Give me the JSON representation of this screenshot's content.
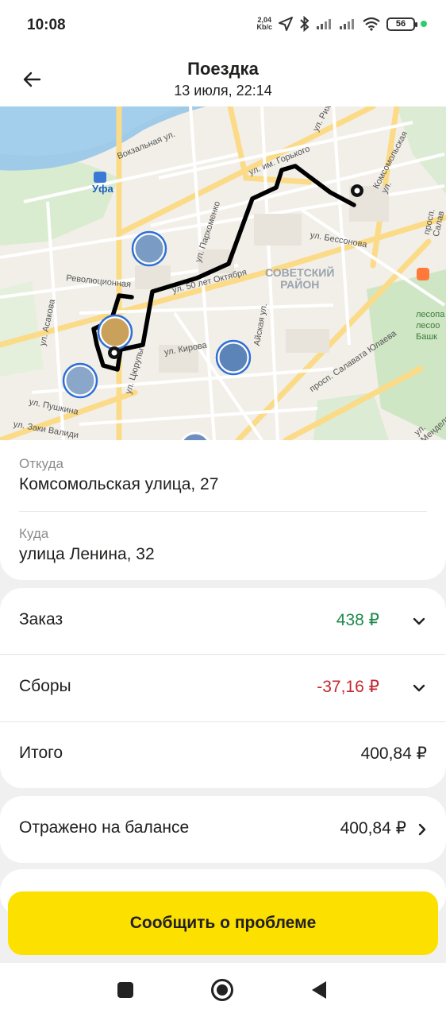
{
  "status_bar": {
    "time": "10:08",
    "net_speed_value": "2,04",
    "net_speed_unit": "Kb/c",
    "battery": "56"
  },
  "header": {
    "title": "Поездка",
    "subtitle": "13 июля, 22:14",
    "back_icon": "arrow-left-icon"
  },
  "map": {
    "streets": [
      "ул. Рихард",
      "Комсомольская ул.",
      "просп. Салав",
      "ул. им. Горького",
      "Вокзальная ул.",
      "ул. Пархоменко",
      "ул. Бессонова",
      "Революционная",
      "ул. 50 лет Октября",
      "ул. Асакова",
      "ул. Кирова",
      "Айская ул.",
      "ул. Цюрупы",
      "ул. Пушкина",
      "ул. Заки Валиди",
      "просп. Салавата Юлаева",
      "ул. Менделе"
    ],
    "district_line1": "СОВЕТСКИЙ",
    "district_line2": "РАЙОН",
    "station": "Уфа",
    "park_line1": "лесопа",
    "park_line2": "лесоо",
    "park_line3": "Башк"
  },
  "address": {
    "from_label": "Откуда",
    "from_value": "Комсомольская улица, 27",
    "to_label": "Куда",
    "to_value": "улица Ленина, 32"
  },
  "costs": {
    "order_label": "Заказ",
    "order_value": "438 ₽",
    "fees_label": "Сборы",
    "fees_value": "-37,16 ₽",
    "total_label": "Итого",
    "total_value": "400,84 ₽",
    "colors": {
      "positive": "#1f8a4c",
      "negative": "#c5282f"
    }
  },
  "balance": {
    "label": "Отражено на балансе",
    "value": "400,84 ₽"
  },
  "actions": {
    "report_label": "Сообщить о проблеме",
    "accent": "#fce000"
  }
}
